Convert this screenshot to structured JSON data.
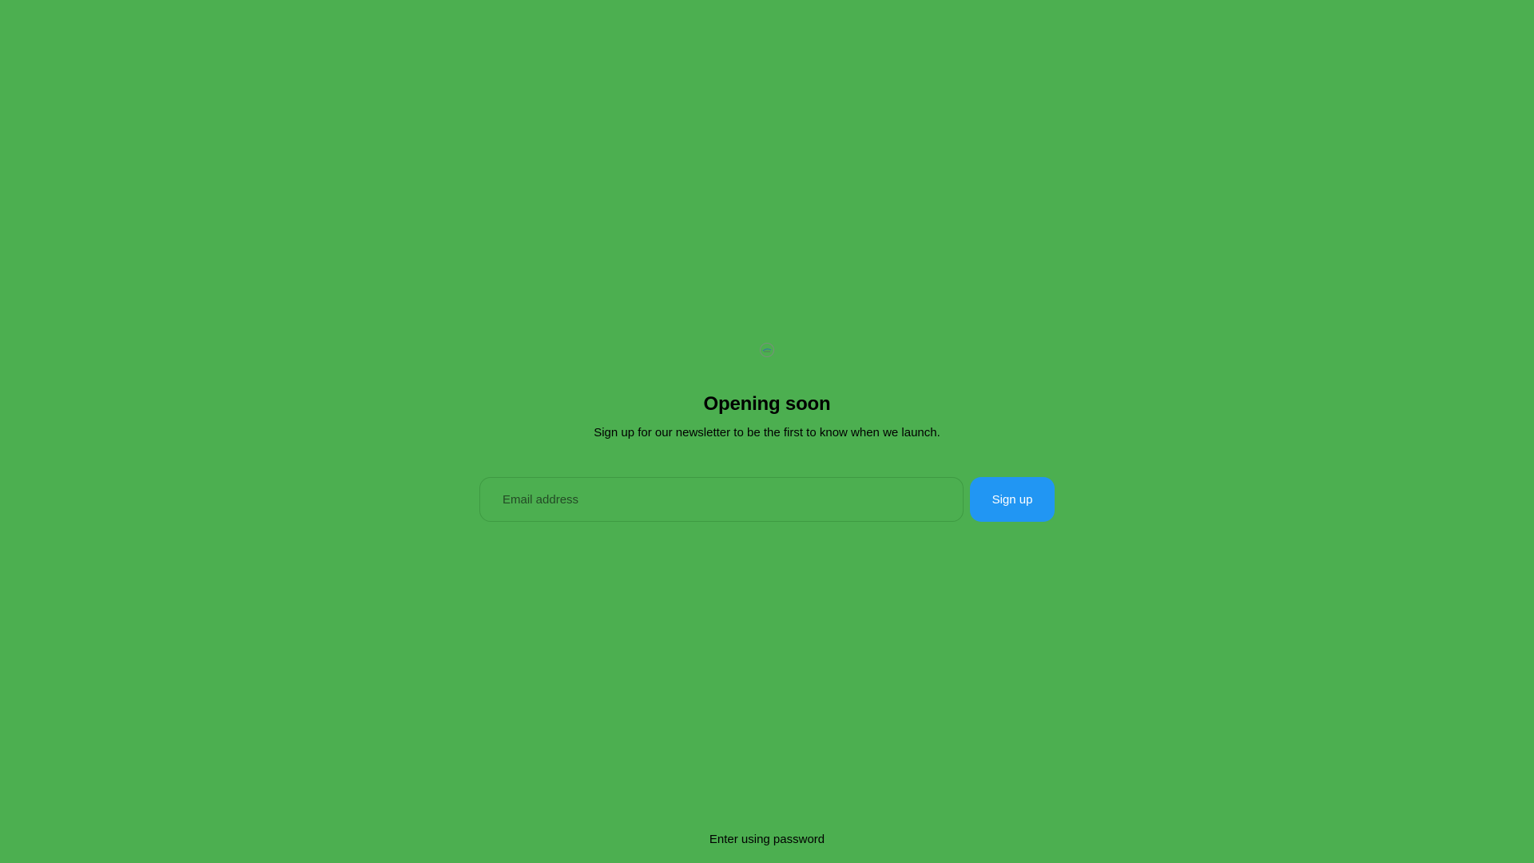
{
  "page": {
    "background_color": "#4caf50"
  },
  "logo": {
    "icon": "circle-logo-icon"
  },
  "hero": {
    "title": "Opening soon",
    "subtitle": "Sign up for our newsletter to be the first to know when we launch."
  },
  "newsletter": {
    "email_placeholder": "Email address",
    "email_value": "",
    "submit_label": "Sign up",
    "submit_color": "#2196f3"
  },
  "footer": {
    "password_link_label": "Enter using password"
  }
}
